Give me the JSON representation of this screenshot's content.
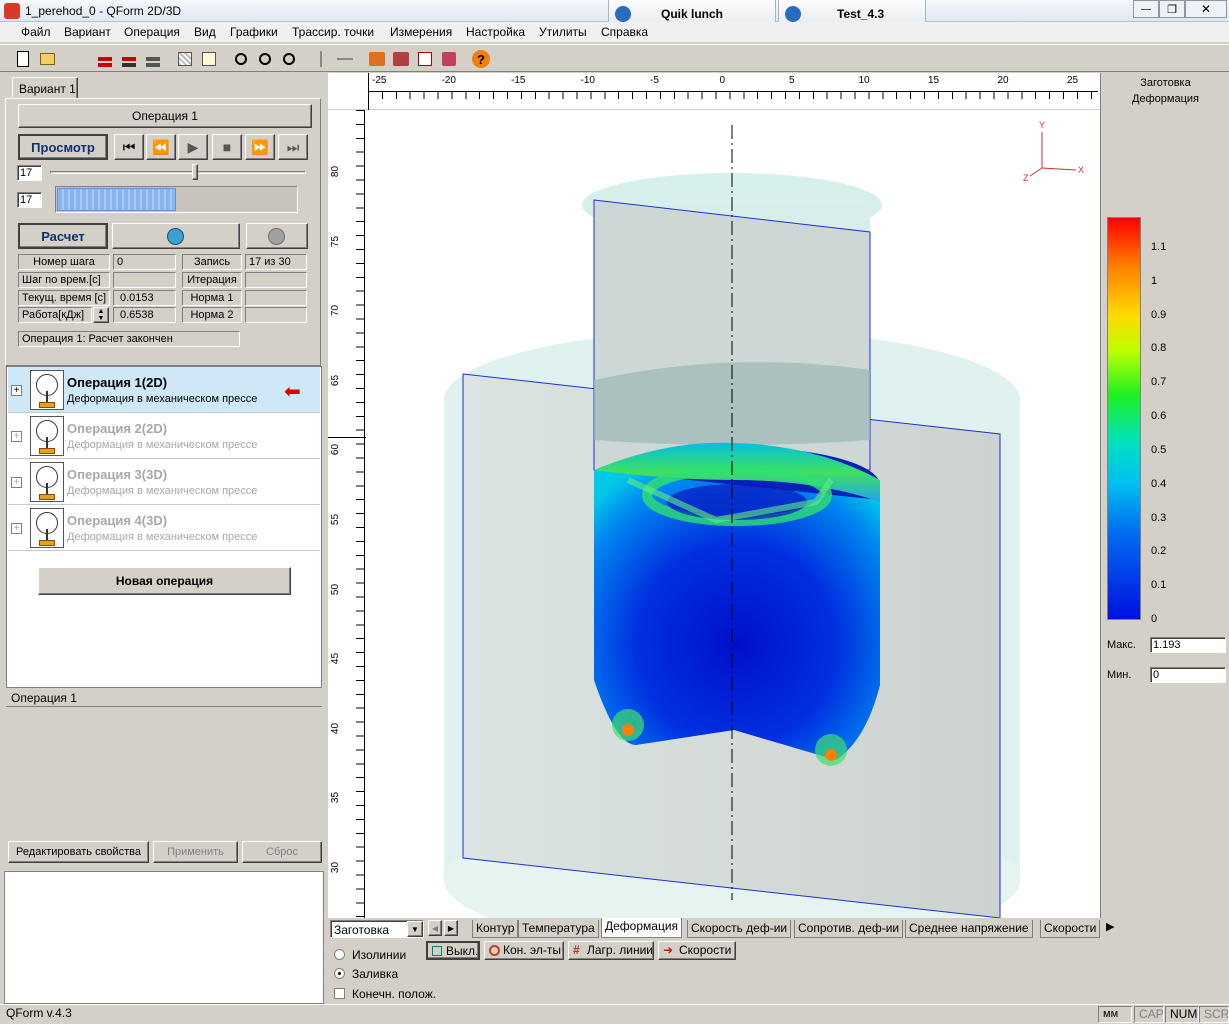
{
  "window": {
    "title": "1_perehod_0 - QForm 2D/3D",
    "taskbar_tabs": [
      "Quik lunch",
      "Test_4.3"
    ],
    "controls": [
      "—",
      "❐",
      "✕"
    ]
  },
  "menu": [
    "Файл",
    "Вариант",
    "Операция",
    "Вид",
    "Графики",
    "Трассир. точки",
    "Измерения",
    "Настройка",
    "Утилиты",
    "Справка"
  ],
  "left": {
    "variant_tab": "Вариант 1",
    "operation_button": "Операция 1",
    "view_button": "Просмотр",
    "calc_button": "Расчет",
    "frame_value": "17",
    "progress_value": "17",
    "progress_fraction": 0.5,
    "info": {
      "step_label": "Номер шага",
      "step_value": "0",
      "record_label": "Запись",
      "record_value": "17 из 30",
      "timestep_label": "Шаг по врем.[с]",
      "timestep_value": "",
      "iteration_label": "Итерация",
      "iteration_value": "",
      "time_label": "Текущ. время [с]",
      "time_value": "0.0153",
      "norm1_label": "Норма 1",
      "norm1_value": "",
      "work_label": "Работа[кДж]",
      "work_value": "0.6538",
      "norm2_label": "Норма 2",
      "norm2_value": ""
    },
    "status_line": "Операция 1: Расчет закончен",
    "operations": [
      {
        "title": "Операция 1(2D)",
        "subtitle": "Деформация в механическом прессе",
        "active": true
      },
      {
        "title": "Операция 2(2D)",
        "subtitle": "Деформация в механическом прессе",
        "active": false
      },
      {
        "title": "Операция 3(3D)",
        "subtitle": "Деформация в механическом прессе",
        "active": false
      },
      {
        "title": "Операция 4(3D)",
        "subtitle": "Деформация в механическом прессе",
        "active": false
      }
    ],
    "new_operation": "Новая операция",
    "props_header": "Операция 1",
    "edit_props": "Редактировать свойства",
    "apply": "Применить",
    "reset": "Сброс"
  },
  "ruler": {
    "x_ticks": [
      "-25",
      "-20",
      "-15",
      "-10",
      "-5",
      "0",
      "5",
      "10",
      "15",
      "20",
      "25"
    ],
    "y_ticks": [
      "80",
      "75",
      "70",
      "65",
      "60",
      "55",
      "50",
      "45",
      "40",
      "35",
      "30"
    ]
  },
  "axes": {
    "x": "X",
    "y": "Y",
    "z": "Z"
  },
  "colorbar": {
    "header1": "Заготовка",
    "header2": "Деформация",
    "ticks": [
      "1.1",
      "1",
      "0.9",
      "0.8",
      "0.7",
      "0.6",
      "0.5",
      "0.4",
      "0.3",
      "0.2",
      "0.1",
      "0"
    ],
    "max_label": "Макс.",
    "max_value": "1.193",
    "min_label": "Мин.",
    "min_value": "0"
  },
  "bottom": {
    "object_select": "Заготовка",
    "tabs": [
      "Контур",
      "Температура",
      "Деформация",
      "Скорость деф-ии",
      "Сопротив. деф-ии",
      "Среднее напряжение",
      "Скорости"
    ],
    "active_tab": "Деформация",
    "radio_isolines": "Изолинии",
    "radio_fill": "Заливка",
    "check_final": "Конечн. полож.",
    "btn_off": "Выкл.",
    "btn_elements": "Кон. эл-ты",
    "btn_lagrange": "Лагр. линии",
    "btn_velocities": "Скорости"
  },
  "statusbar": {
    "version": "QForm v.4.3",
    "units": "мм",
    "cap": "CAP",
    "num": "NUM",
    "scrl": "SCRL"
  },
  "colors": {
    "accent_blue": "#3aa0d0",
    "selected_row": "#cfe8f8",
    "arrow_red": "#e00000"
  }
}
